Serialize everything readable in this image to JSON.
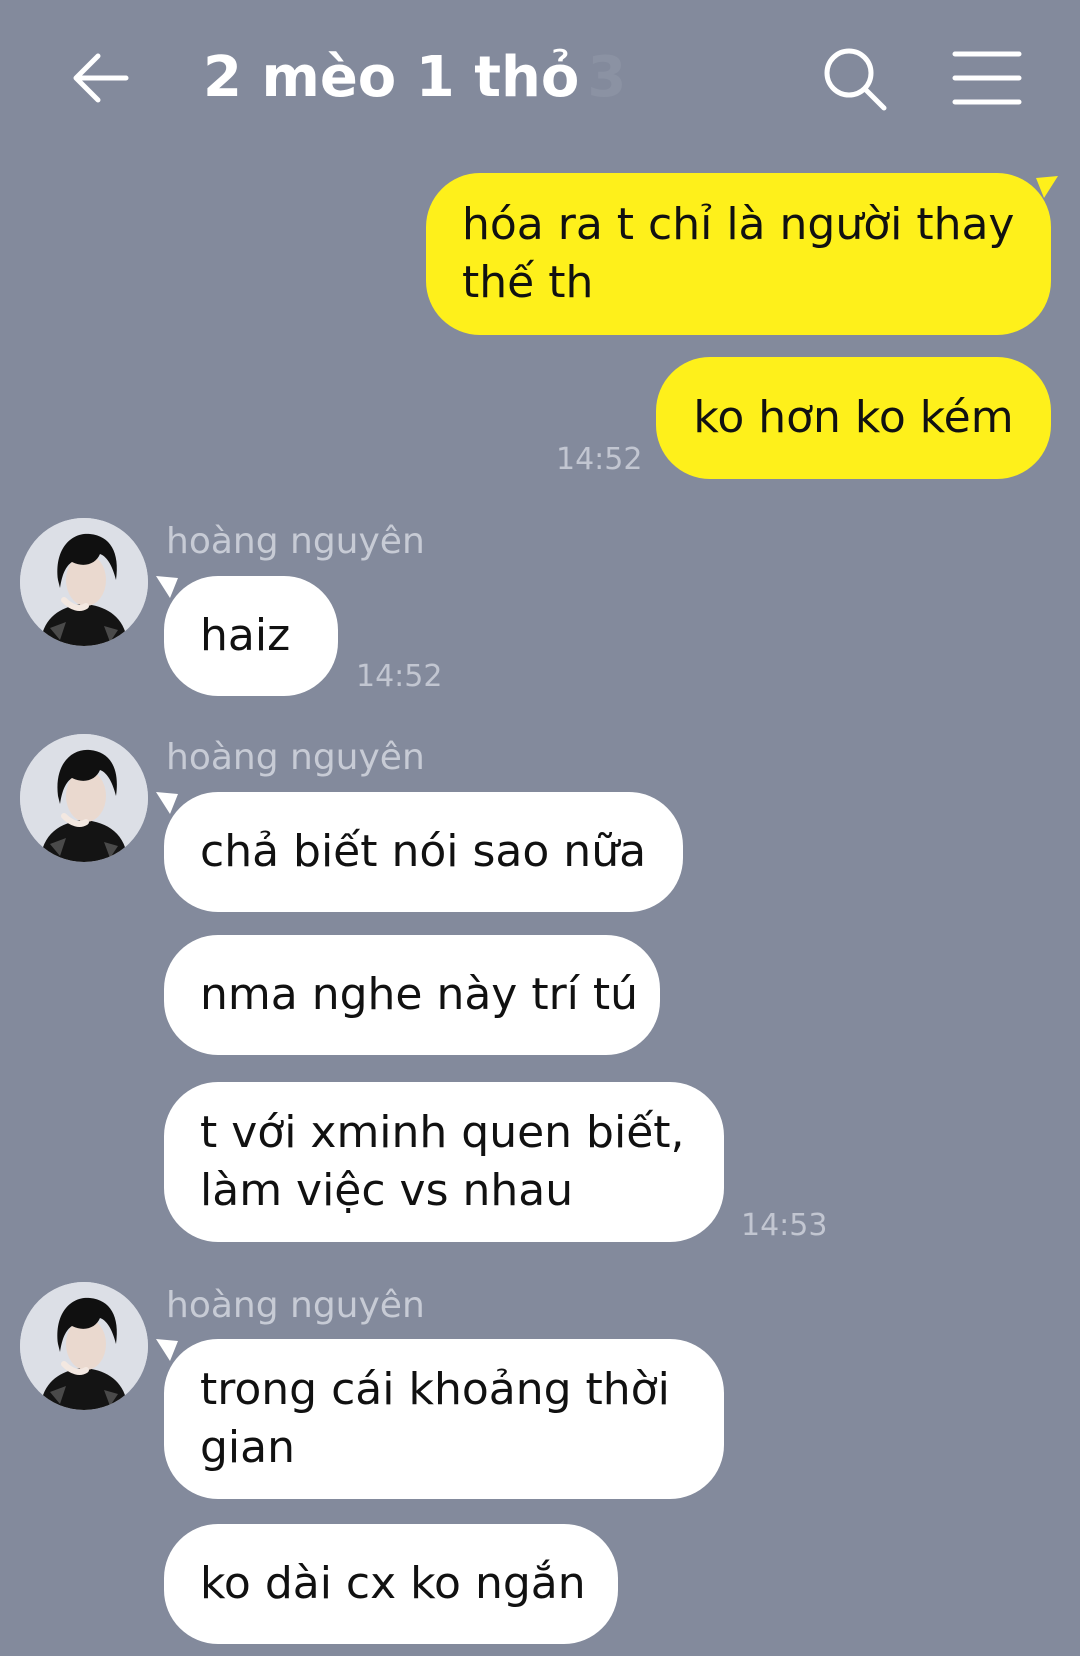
{
  "header": {
    "title": "2 mèo 1 thỏ",
    "member_count": "3"
  },
  "icons": {
    "back": "arrow-left-icon",
    "search": "search-icon",
    "menu": "hamburger-menu-icon",
    "avatar": "profile-photo"
  },
  "colors": {
    "background": "#838a9c",
    "outgoing_bubble": "#fef01b",
    "incoming_bubble": "#ffffff"
  },
  "messages": {
    "out1": {
      "line1": "hóa ra t chỉ là người thay",
      "line2": "thế th"
    },
    "out2": {
      "text": "ko hơn ko kém",
      "time": "14:52"
    },
    "group1": {
      "sender": "hoàng nguyên",
      "text": "haiz",
      "time": "14:52"
    },
    "group2": {
      "sender": "hoàng nguyên",
      "msg1": "chả biết nói sao nữa",
      "msg2": "nma nghe này trí tú",
      "msg3_line1": "t với xminh quen biết,",
      "msg3_line2": "làm việc vs nhau",
      "time": "14:53"
    },
    "group3": {
      "sender": "hoàng nguyên",
      "msg1_line1": "trong cái khoảng thời",
      "msg1_line2": "gian",
      "msg2": "ko dài cx ko ngắn"
    }
  }
}
